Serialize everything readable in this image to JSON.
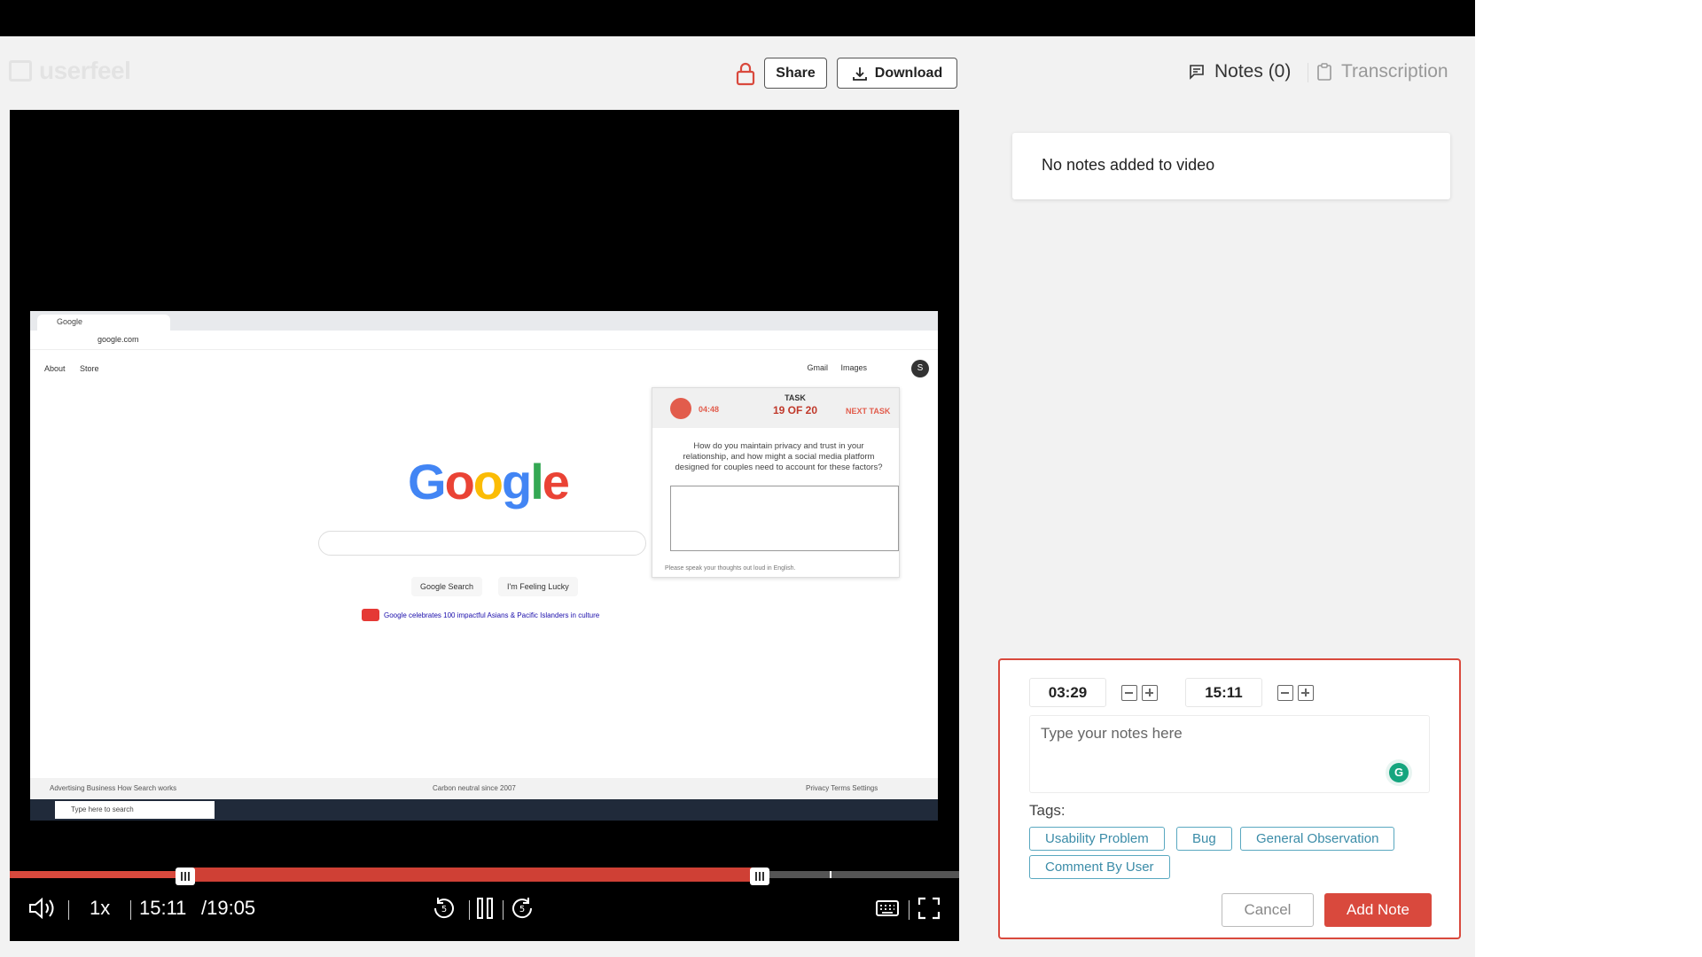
{
  "app": {
    "logo_text": "userfeel"
  },
  "header": {
    "share_label": "Share",
    "download_label": "Download"
  },
  "tabs": {
    "notes_label": "Notes (0)",
    "transcription_label": "Transcription"
  },
  "notes": {
    "empty_message": "No notes added to video"
  },
  "note_form": {
    "start_time": "03:29",
    "end_time": "15:11",
    "placeholder": "Type your notes here",
    "tags_label": "Tags:",
    "tags": [
      "Usability Problem",
      "Bug",
      "General Observation",
      "Comment By User"
    ],
    "cancel_label": "Cancel",
    "add_label": "Add Note"
  },
  "player": {
    "speed": "1x",
    "current_time": "15:11",
    "duration": "/19:05",
    "played_fraction": 0.795,
    "range_start_fraction": 0.18,
    "range_end_fraction": 0.795
  },
  "recording": {
    "tab_title": "Google",
    "url": "google.com",
    "top_links_left": "About Store",
    "top_links_right": "Gmail Images",
    "avatar_letter": "S",
    "search_button": "Google Search",
    "lucky_button": "I'm Feeling Lucky",
    "promo": "Google celebrates 100 impactful Asians & Pacific Islanders in culture",
    "footer_left": "Advertising   Business   How Search works",
    "footer_center": "Carbon neutral since 2007",
    "footer_right": "Privacy   Terms   Settings",
    "taskbar_search": "Type here to search",
    "task_widget": {
      "timer": "04:48",
      "task_label": "TASK",
      "task_count": "19 OF 20",
      "next_label": "NEXT TASK",
      "question": "How do you maintain privacy and trust in your relationship, and how might a social media platform designed for couples need to account for these factors?",
      "footer": "Please speak your thoughts out loud in English."
    }
  },
  "colors": {
    "accent": "#d9493d",
    "tag": "#3b8ca8",
    "grammarly": "#15a57e"
  }
}
